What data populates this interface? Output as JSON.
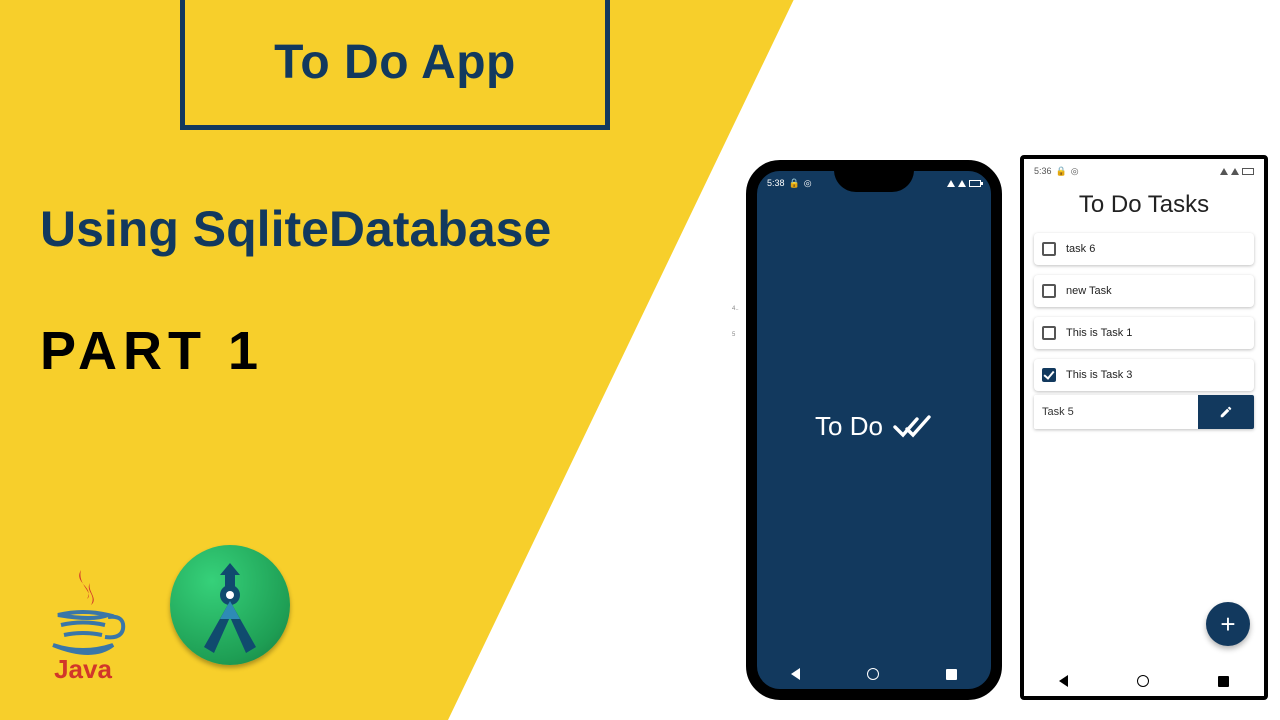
{
  "colors": {
    "brand": "#12395e",
    "yellow": "#f7cf2b",
    "javaRed": "#d1362a",
    "asGreen": "#1e9e54"
  },
  "title_box": {
    "text": "To Do App"
  },
  "subtitle": "Using SqliteDatabase",
  "part_label": "PART 1",
  "logos": {
    "java_label": "Java"
  },
  "phone1": {
    "status_time": "5:38",
    "splash_text": "To Do"
  },
  "phone2": {
    "status_time": "5:36",
    "header": "To Do Tasks",
    "tasks": [
      {
        "label": "task 6",
        "checked": false
      },
      {
        "label": "new Task",
        "checked": false
      },
      {
        "label": "This is Task 1",
        "checked": false
      },
      {
        "label": "This is Task 3",
        "checked": true
      }
    ],
    "edit_row_label": "Task 5",
    "fab_label": "+"
  }
}
